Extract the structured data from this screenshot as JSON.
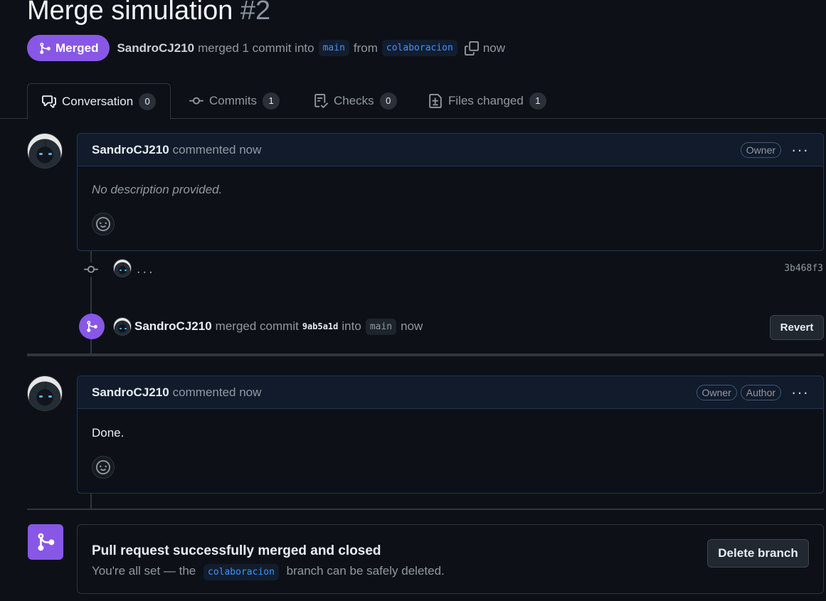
{
  "pr": {
    "title": "Merge simulation",
    "number": "#2",
    "state": "Merged",
    "author": "SandroCJ210",
    "summary": "merged 1 commit into",
    "base_branch": "main",
    "from_text": "from",
    "head_branch": "colaboracion",
    "time": "now"
  },
  "tabs": [
    {
      "label": "Conversation",
      "count": "0",
      "icon": "comment-discussion-icon"
    },
    {
      "label": "Commits",
      "count": "1",
      "icon": "git-commit-icon"
    },
    {
      "label": "Checks",
      "count": "0",
      "icon": "checklist-icon"
    },
    {
      "label": "Files changed",
      "count": "1",
      "icon": "file-diff-icon"
    }
  ],
  "comment1": {
    "author": "SandroCJ210",
    "meta": "commented now",
    "role": "Owner",
    "body": "No description provided."
  },
  "commit": {
    "dots": "...",
    "sha": "3b468f3"
  },
  "merge_event": {
    "author": "SandroCJ210",
    "text1": "merged commit",
    "sha": "9ab5a1d",
    "text2": "into",
    "branch": "main",
    "time": "now",
    "revert_label": "Revert"
  },
  "comment2": {
    "author": "SandroCJ210",
    "meta": "commented now",
    "role1": "Owner",
    "role2": "Author",
    "body": "Done."
  },
  "merged_panel": {
    "title": "Pull request successfully merged and closed",
    "text_before": "You're all set — the",
    "branch": "colaboracion",
    "text_after": "branch can be safely deleted.",
    "delete_label": "Delete branch"
  },
  "colors": {
    "merged_purple": "#8957e5",
    "background": "#0d1117",
    "link_blue": "#4493f8"
  }
}
